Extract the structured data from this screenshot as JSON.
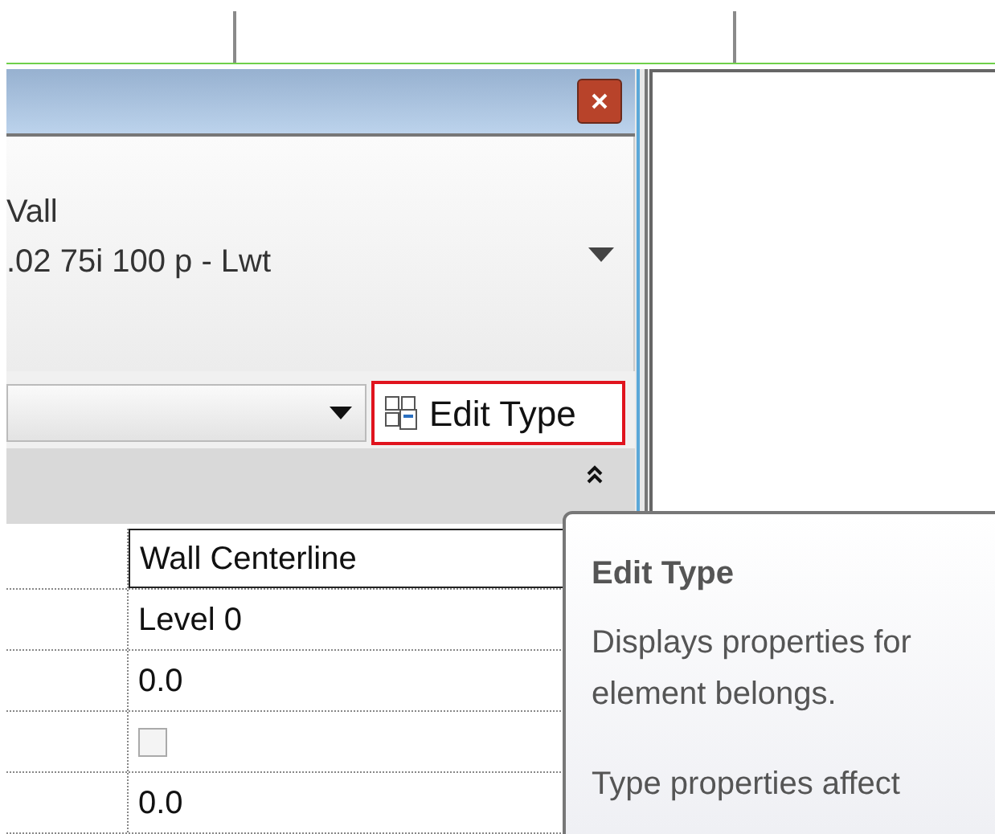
{
  "type_selector": {
    "family": "Vall",
    "type": ".02 75i 100 p - Lwt"
  },
  "edit_type_button": {
    "label": "Edit Type",
    "highlighted": true
  },
  "properties": [
    {
      "kind": "text",
      "value": "Wall Centerline",
      "selected": true
    },
    {
      "kind": "text",
      "value": "Level 0",
      "selected": false
    },
    {
      "kind": "text",
      "value": "0.0",
      "selected": false
    },
    {
      "kind": "checkbox",
      "checked": false,
      "selected": false
    },
    {
      "kind": "text",
      "value": "0.0",
      "selected": false
    }
  ],
  "tooltip": {
    "title": "Edit Type",
    "lines": [
      "Displays properties for",
      "element belongs.",
      "Type properties affect"
    ]
  }
}
